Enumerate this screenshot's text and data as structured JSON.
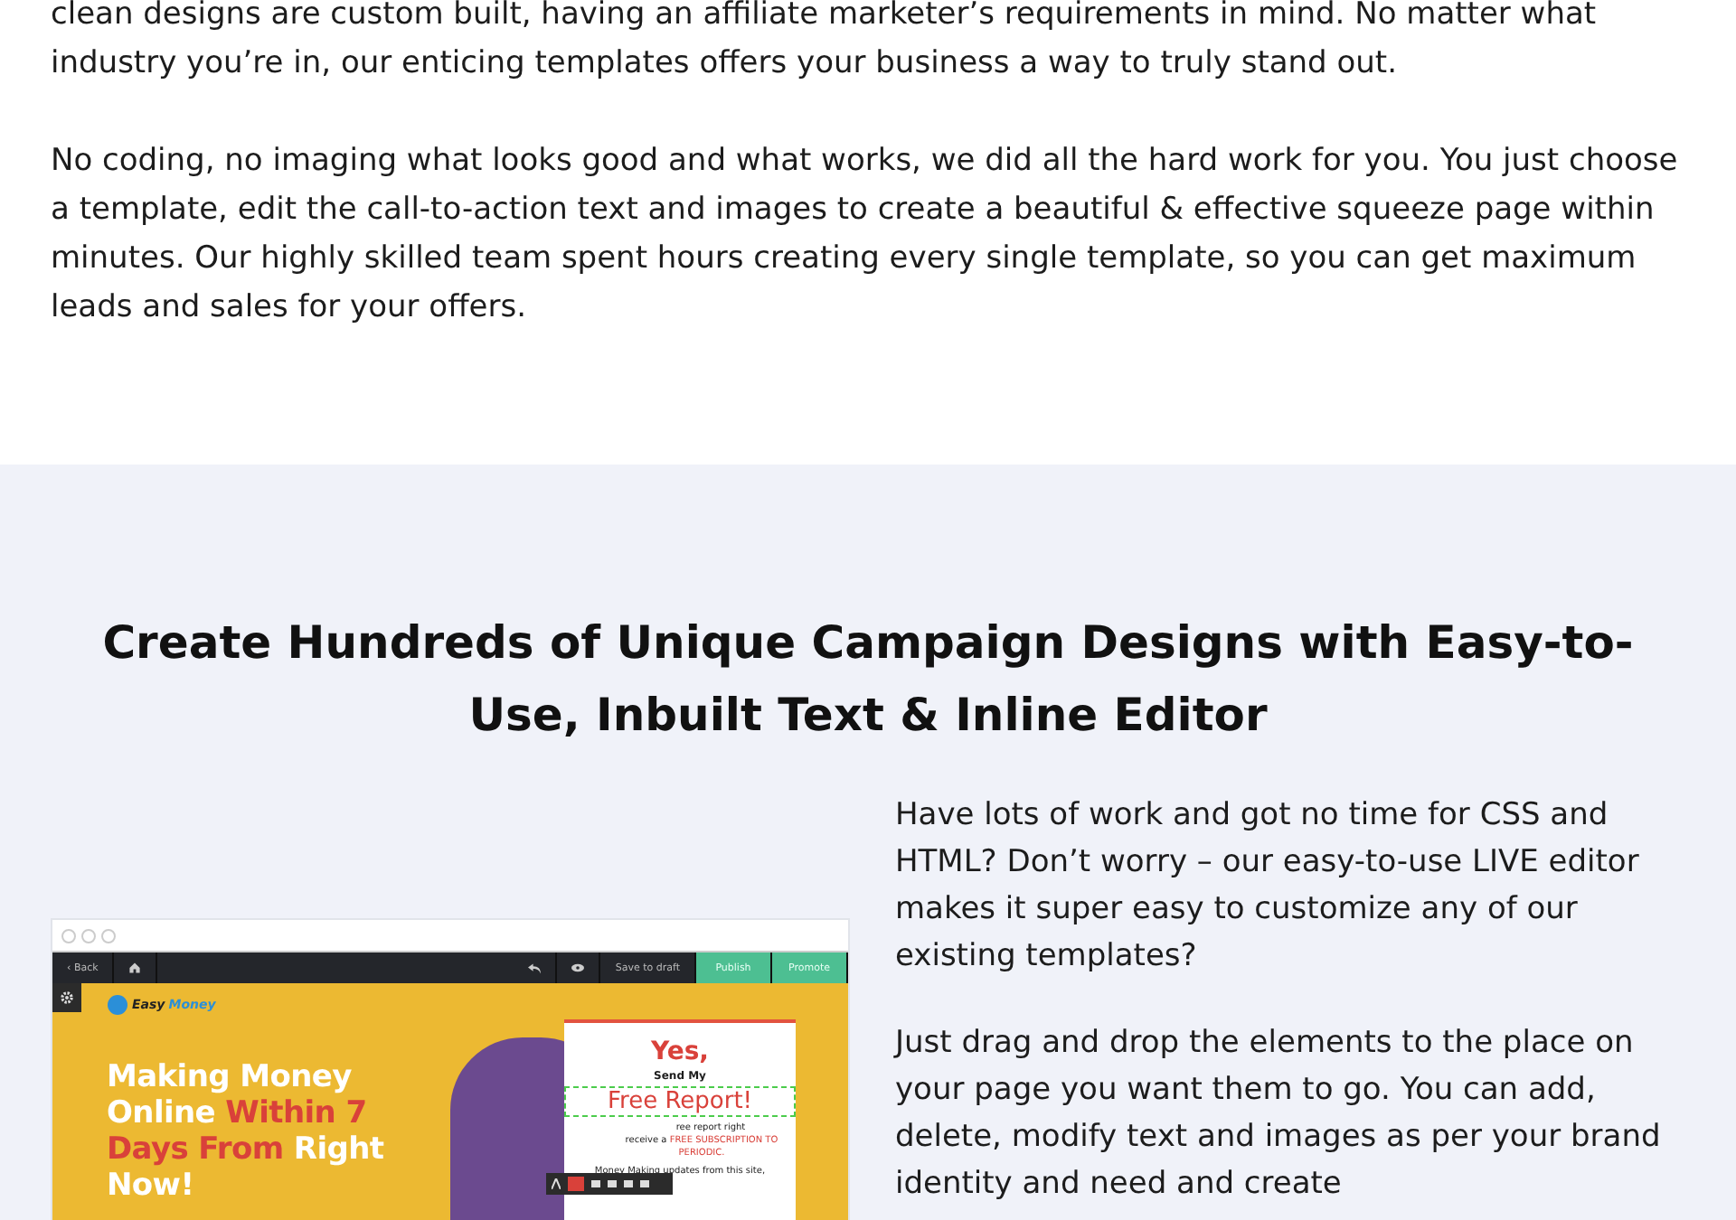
{
  "intro": {
    "paragraphs": [
      "clean designs are custom built, having an affiliate marketer’s requirements in mind. No matter what industry you’re in, our enticing templates offers your business a way to truly stand out.",
      "No coding, no imaging what looks good and what works, we did all the hard work for you. You just choose a template, edit the call-to-action text and images to create a beautiful & effective squeeze page within minutes. Our highly skilled team spent hours creating every single template, so you can get maximum leads and sales for your offers."
    ]
  },
  "feature": {
    "heading": "Create Hundreds of Unique Campaign Designs with Easy-to-Use, Inbuilt Text & Inline Editor",
    "editor_preview": {
      "toolbar": {
        "back": "‹ Back",
        "save": "Save to draft",
        "publish": "Publish",
        "promote": "Promote"
      },
      "logo": [
        {
          "text": "Easy",
          "accent": false
        },
        {
          "text": "Money",
          "accent": true
        }
      ],
      "headline": [
        {
          "text": "Making Money Online",
          "accent": false
        },
        {
          "text": "Within 7 Days From",
          "accent": true
        },
        {
          "text": "Right Now!",
          "accent": false
        }
      ],
      "form": {
        "title": "Yes,",
        "subtitle": "Send My",
        "offer": "Free Report!",
        "line_1": "ree report right",
        "line_2_start": "receive a",
        "line_2_accent": "FREE SUBSCRIPTION TO PERIODIC.",
        "line_3": "Money Making updates from this site,"
      }
    },
    "paragraphs": [
      "Have lots of work and got no time for CSS and HTML? Don’t worry – our easy-to-use LIVE editor makes it super easy to customize any of our existing templates?",
      "Just drag and drop the elements to the place on your page you want them to go. You can add, delete, modify text and images as per your brand identity and need and create"
    ]
  }
}
